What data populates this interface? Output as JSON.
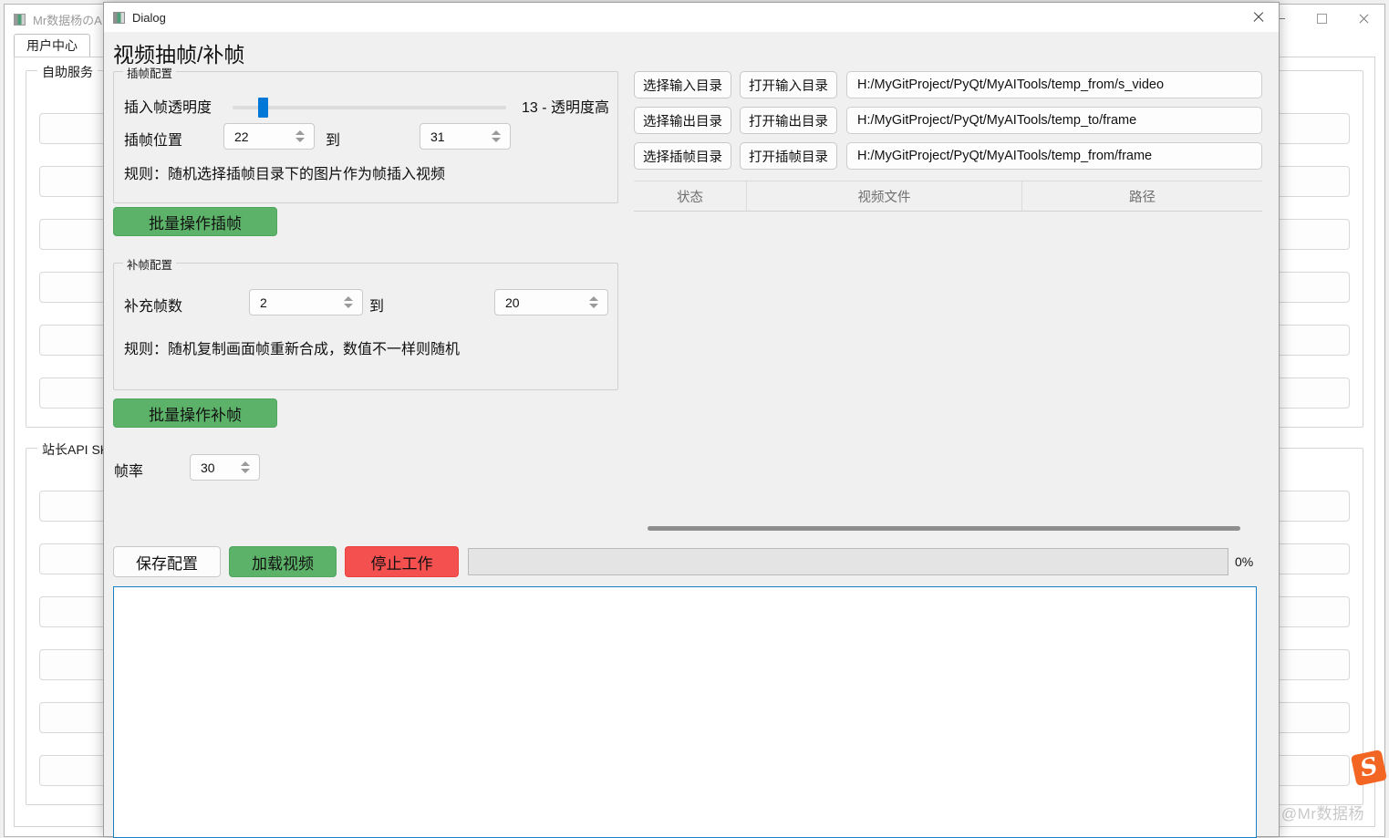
{
  "background_window": {
    "title": "Mr数据杨のAI工",
    "icon": "app-icon",
    "window_controls": {
      "minimize": "minimize-icon",
      "maximize": "maximize-icon",
      "close": "close-icon"
    },
    "tabs": [
      {
        "label": "用户中心",
        "active": true
      }
    ],
    "groups": [
      {
        "label": "自助服务",
        "rows": 6
      },
      {
        "label": "站长API SK",
        "rows": 6
      }
    ],
    "watermark": "CSDN @Mr数据杨",
    "ime_badge": "S"
  },
  "dialog": {
    "titlebar": {
      "title": "Dialog",
      "icon": "app-icon",
      "close": "close-icon"
    },
    "heading": "视频抽帧/补帧",
    "insert_group": {
      "title": "插帧配置",
      "opacity_label": "插入帧透明度",
      "opacity_value": 13,
      "opacity_value_text": "13 - 透明度高",
      "position_label": "插帧位置",
      "position_from": "22",
      "position_to_label": "到",
      "position_to": "31",
      "rule": "规则：随机选择插帧目录下的图片作为帧插入视频"
    },
    "batch_insert_button": "批量操作插帧",
    "fill_group": {
      "title": "补帧配置",
      "count_label": "补充帧数",
      "count_from": "2",
      "count_to_label": "到",
      "count_to": "20",
      "rule": "规则：随机复制画面帧重新合成，数值不一样则随机"
    },
    "batch_fill_button": "批量操作补帧",
    "fps_label": "帧率",
    "fps_value": "30",
    "bottom_bar": {
      "save_config": "保存配置",
      "load_video": "加载视频",
      "stop_work": "停止工作",
      "progress_percent": "0%",
      "progress_value": 0
    },
    "directories": [
      {
        "choose": "选择输入目录",
        "open": "打开输入目录",
        "path": "H:/MyGitProject/PyQt/MyAITools/temp_from/s_video"
      },
      {
        "choose": "选择输出目录",
        "open": "打开输出目录",
        "path": "H:/MyGitProject/PyQt/MyAITools/temp_to/frame"
      },
      {
        "choose": "选择插帧目录",
        "open": "打开插帧目录",
        "path": "H:/MyGitProject/PyQt/MyAITools/temp_from/frame"
      }
    ],
    "table": {
      "columns": [
        "状态",
        "视频文件",
        "路径"
      ],
      "rows": []
    },
    "log_area": {
      "content": ""
    }
  },
  "colors": {
    "green_button": "#5cb269",
    "red_button": "#f4504f",
    "slider_handle": "#0078d7",
    "log_border": "#1a82c4",
    "dialog_bg": "#f0f0f0"
  }
}
